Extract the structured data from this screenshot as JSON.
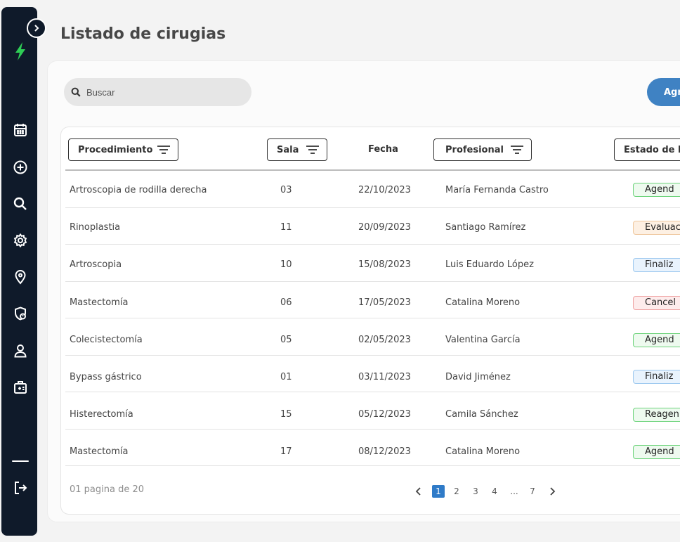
{
  "page": {
    "title": "Listado de cirugias"
  },
  "search": {
    "placeholder": "Buscar"
  },
  "actions": {
    "add_label": "Agr"
  },
  "table": {
    "headers": {
      "procedimiento": "Procedimiento",
      "sala": "Sala",
      "fecha": "Fecha",
      "profesional": "Profesional",
      "estado": "Estado de la"
    },
    "rows": [
      {
        "procedimiento": "Artroscopia de rodilla derecha",
        "sala": "03",
        "fecha": "22/10/2023",
        "profesional": "María Fernanda Castro",
        "estado": "Agend",
        "estado_color": "#6cd37a"
      },
      {
        "procedimiento": "Rinoplastia",
        "sala": "11",
        "fecha": "20/09/2023",
        "profesional": "Santiago Ramírez",
        "estado": "Evaluac",
        "estado_color": "#efc79d"
      },
      {
        "procedimiento": "Artroscopia",
        "sala": "10",
        "fecha": "15/08/2023",
        "profesional": "Luis Eduardo López",
        "estado": "Finaliz",
        "estado_color": "#9cc8ef"
      },
      {
        "procedimiento": "Mastectomía",
        "sala": "06",
        "fecha": "17/05/2023",
        "profesional": "Catalina Moreno",
        "estado": "Cancel",
        "estado_color": "#efa3a3"
      },
      {
        "procedimiento": "Colecistectomía",
        "sala": "05",
        "fecha": "02/05/2023",
        "profesional": "Valentina García",
        "estado": "Agend",
        "estado_color": "#6cd37a"
      },
      {
        "procedimiento": "Bypass gástrico",
        "sala": "01",
        "fecha": "03/11/2023",
        "profesional": "David Jiménez",
        "estado": "Finaliz",
        "estado_color": "#9cc8ef"
      },
      {
        "procedimiento": "Histerectomía",
        "sala": "15",
        "fecha": "05/12/2023",
        "profesional": "Camila Sánchez",
        "estado": "Reagen",
        "estado_color": "#6cd37a"
      },
      {
        "procedimiento": "Mastectomía",
        "sala": "17",
        "fecha": "08/12/2023",
        "profesional": "Catalina Moreno",
        "estado": "Agend",
        "estado_color": "#6cd37a"
      }
    ]
  },
  "pagination": {
    "summary": "01 pagina de 20",
    "pages": [
      "1",
      "2",
      "3",
      "4",
      "...",
      "7"
    ],
    "current": "1"
  },
  "sidebar": {
    "icons": [
      "lightning-logo-icon",
      "calendar-icon",
      "plus-circle-icon",
      "search-icon",
      "gear-icon",
      "location-pin-icon",
      "shield-user-icon",
      "user-icon",
      "medical-id-icon",
      "logout-icon"
    ]
  },
  "colors": {
    "sidebar_bg": "#0f1a2a",
    "brand_green": "#2ecc55",
    "accent_blue": "#3f82c3",
    "page_active": "#2f7bc8"
  }
}
